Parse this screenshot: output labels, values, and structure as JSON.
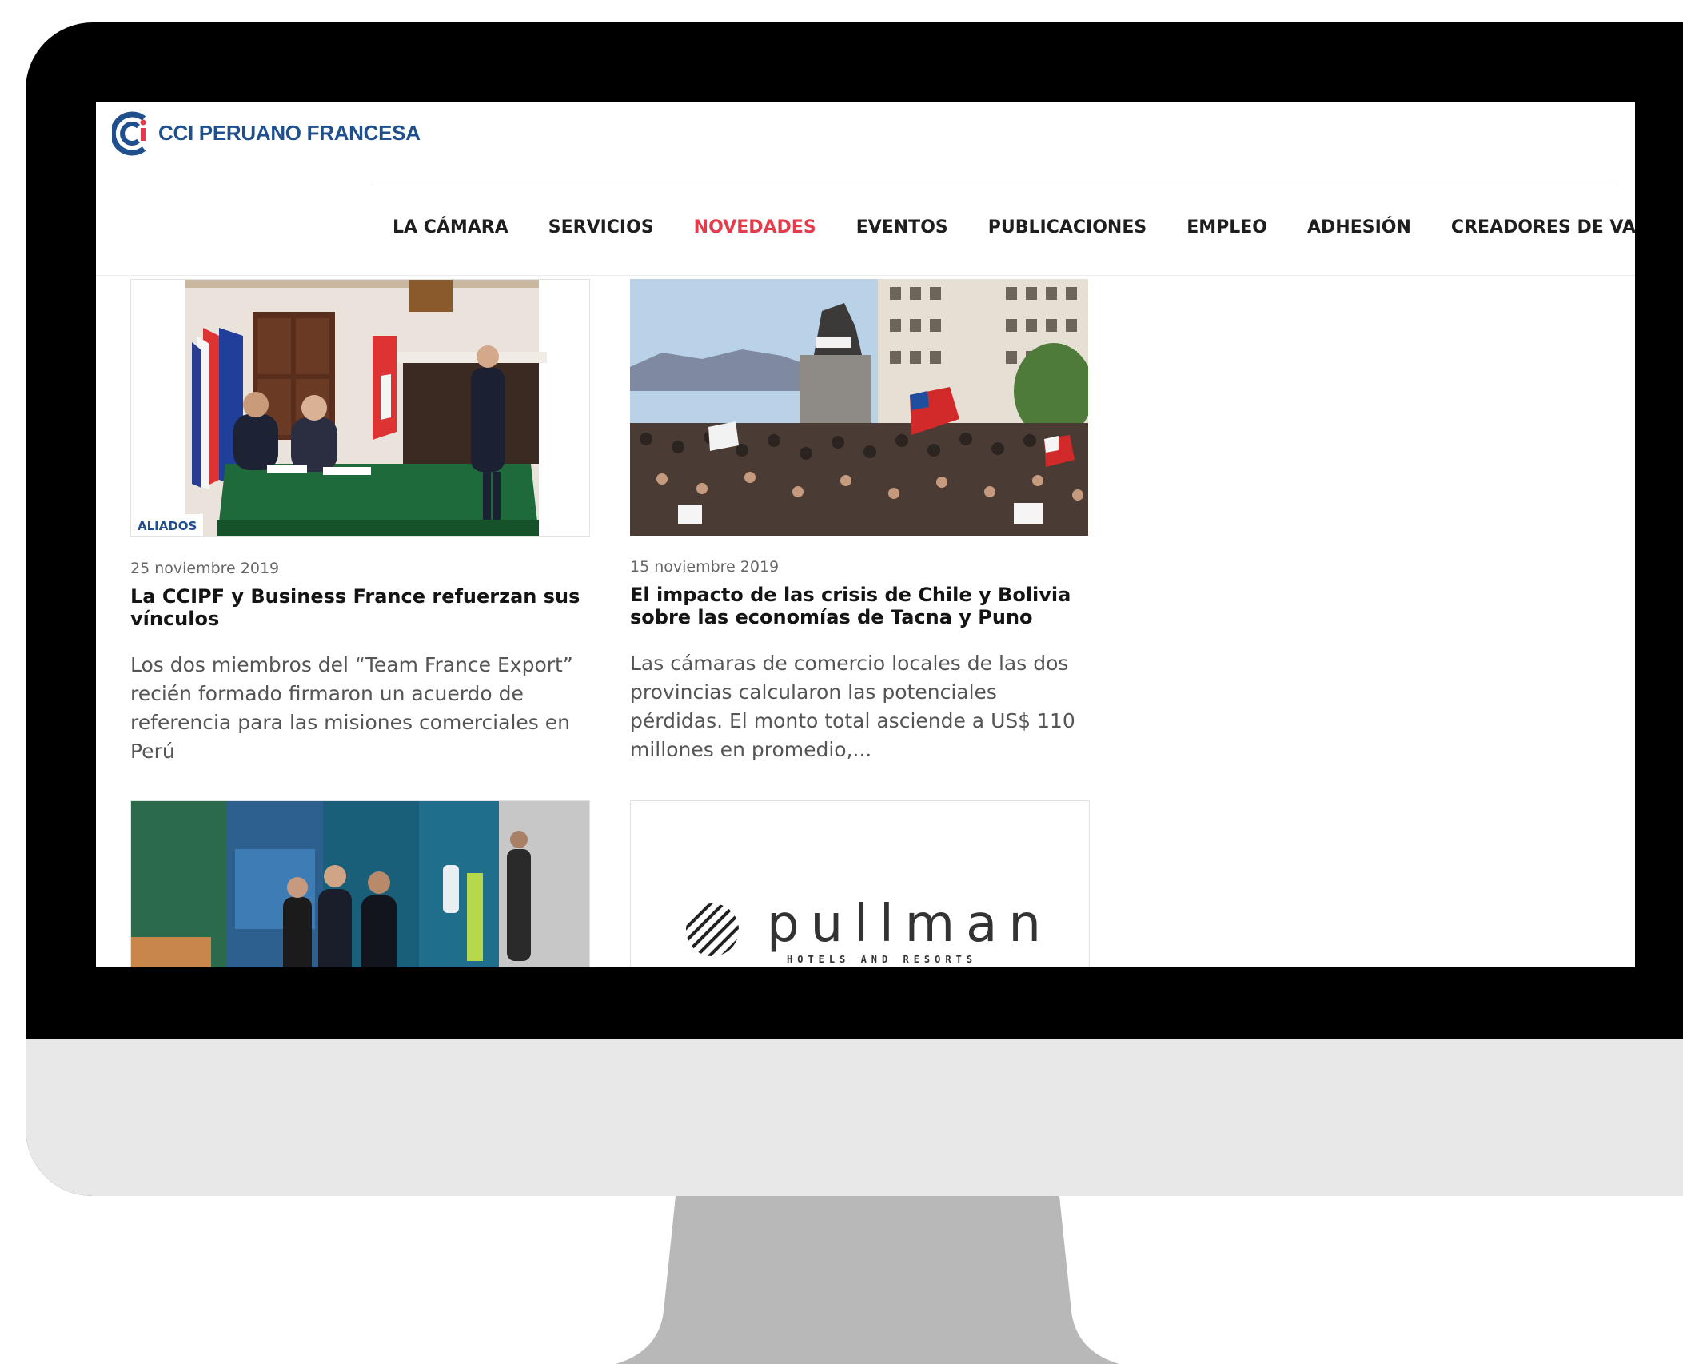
{
  "site": {
    "logo_text": "CCI PERUANO FRANCESA"
  },
  "nav": {
    "items": [
      {
        "label": "LA CÁMARA"
      },
      {
        "label": "SERVICIOS"
      },
      {
        "label": "NOVEDADES"
      },
      {
        "label": "EVENTOS"
      },
      {
        "label": "PUBLICACIONES"
      },
      {
        "label": "EMPLEO"
      },
      {
        "label": "ADHESIÓN"
      },
      {
        "label": "CREADORES DE VALOR"
      }
    ],
    "active_label": "NOVEDADES",
    "active_color": "#e43b4c"
  },
  "posts": [
    {
      "category": "ALIADOS",
      "date": "25 noviembre 2019",
      "title": "La CCIPF y Business France refuerzan sus vínculos",
      "excerpt": "Los dos miembros del “Team France Export” recién formado firmaron un acuerdo de referencia para las misiones comerciales en Perú"
    },
    {
      "date": "15 noviembre 2019",
      "title": "El impacto de las crisis de Chile y Bolivia sobre las economías de Tacna y Puno",
      "excerpt": "Las cámaras de comercio locales de las dos provincias calcularon las potenciales pérdidas. El monto total asciende a US$ 110 millones en promedio,..."
    },
    {
      "image": "expo-stand-photo"
    },
    {
      "image": "pullman-logo",
      "logo_text": "pullman",
      "logo_tagline": "HOTELS AND RESORTS"
    }
  ],
  "colors": {
    "brand_blue": "#1f4f8c",
    "brand_red": "#e43b4c",
    "monitor_chin": "#e8e8e8",
    "monitor_stand": "#b8b8b8"
  }
}
